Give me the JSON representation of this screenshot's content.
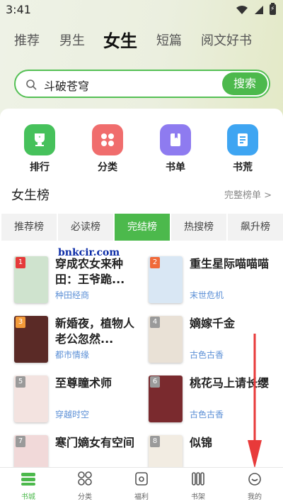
{
  "status": {
    "time": "3:41"
  },
  "top_tabs": [
    {
      "label": "推荐"
    },
    {
      "label": "男生"
    },
    {
      "label": "女生"
    },
    {
      "label": "短篇"
    },
    {
      "label": "阅文好书"
    }
  ],
  "search": {
    "query": "斗破苍穹",
    "button": "搜索"
  },
  "quick_links": [
    {
      "label": "排行",
      "icon": "trophy-icon",
      "color": "#46c15b"
    },
    {
      "label": "分类",
      "icon": "grid-icon",
      "color": "#f06d6d"
    },
    {
      "label": "书单",
      "icon": "book-list-icon",
      "color": "#8e7bf0"
    },
    {
      "label": "书荒",
      "icon": "notebook-icon",
      "color": "#3ea5f2"
    }
  ],
  "ranking": {
    "title": "女生榜",
    "more": "完整榜单 >",
    "tabs": [
      "推荐榜",
      "必读榜",
      "完结榜",
      "热搜榜",
      "飙升榜"
    ],
    "books": [
      {
        "rank": "1",
        "title": "穿成农女来种田：王爷跪...",
        "tag": "种田经商",
        "badge_color": "#e53a3a",
        "cover_color": "#cfe3ce"
      },
      {
        "rank": "2",
        "title": "重生星际喵喵喵",
        "tag": "末世危机",
        "badge_color": "#f06a3a",
        "cover_color": "#d9e7f4"
      },
      {
        "rank": "3",
        "title": "新婚夜，植物人老公忽然...",
        "tag": "都市情缘",
        "badge_color": "#f29a3a",
        "cover_color": "#5a2a26"
      },
      {
        "rank": "4",
        "title": "嫡嫁千金",
        "tag": "古色古香",
        "badge_color": "#9a9a9a",
        "cover_color": "#e9e1d6"
      },
      {
        "rank": "5",
        "title": "至尊瞳术师",
        "tag": "穿越时空",
        "badge_color": "#9a9a9a",
        "cover_color": "#f3e3e0"
      },
      {
        "rank": "6",
        "title": "桃花马上请长缨",
        "tag": "古色古香",
        "badge_color": "#9a9a9a",
        "cover_color": "#7a2a2e"
      },
      {
        "rank": "7",
        "title": "寒门嫡女有空间",
        "tag": "",
        "badge_color": "#9a9a9a",
        "cover_color": "#f1d9d9"
      },
      {
        "rank": "8",
        "title": "似锦",
        "tag": "",
        "badge_color": "#9a9a9a",
        "cover_color": "#f2ece2"
      }
    ]
  },
  "watermark": "bnkcir.com",
  "bottom_nav": [
    {
      "label": "书城",
      "icon": "bookstore-icon"
    },
    {
      "label": "分类",
      "icon": "category-icon"
    },
    {
      "label": "福利",
      "icon": "gift-icon"
    },
    {
      "label": "书架",
      "icon": "bookshelf-icon"
    },
    {
      "label": "我的",
      "icon": "profile-icon"
    }
  ]
}
